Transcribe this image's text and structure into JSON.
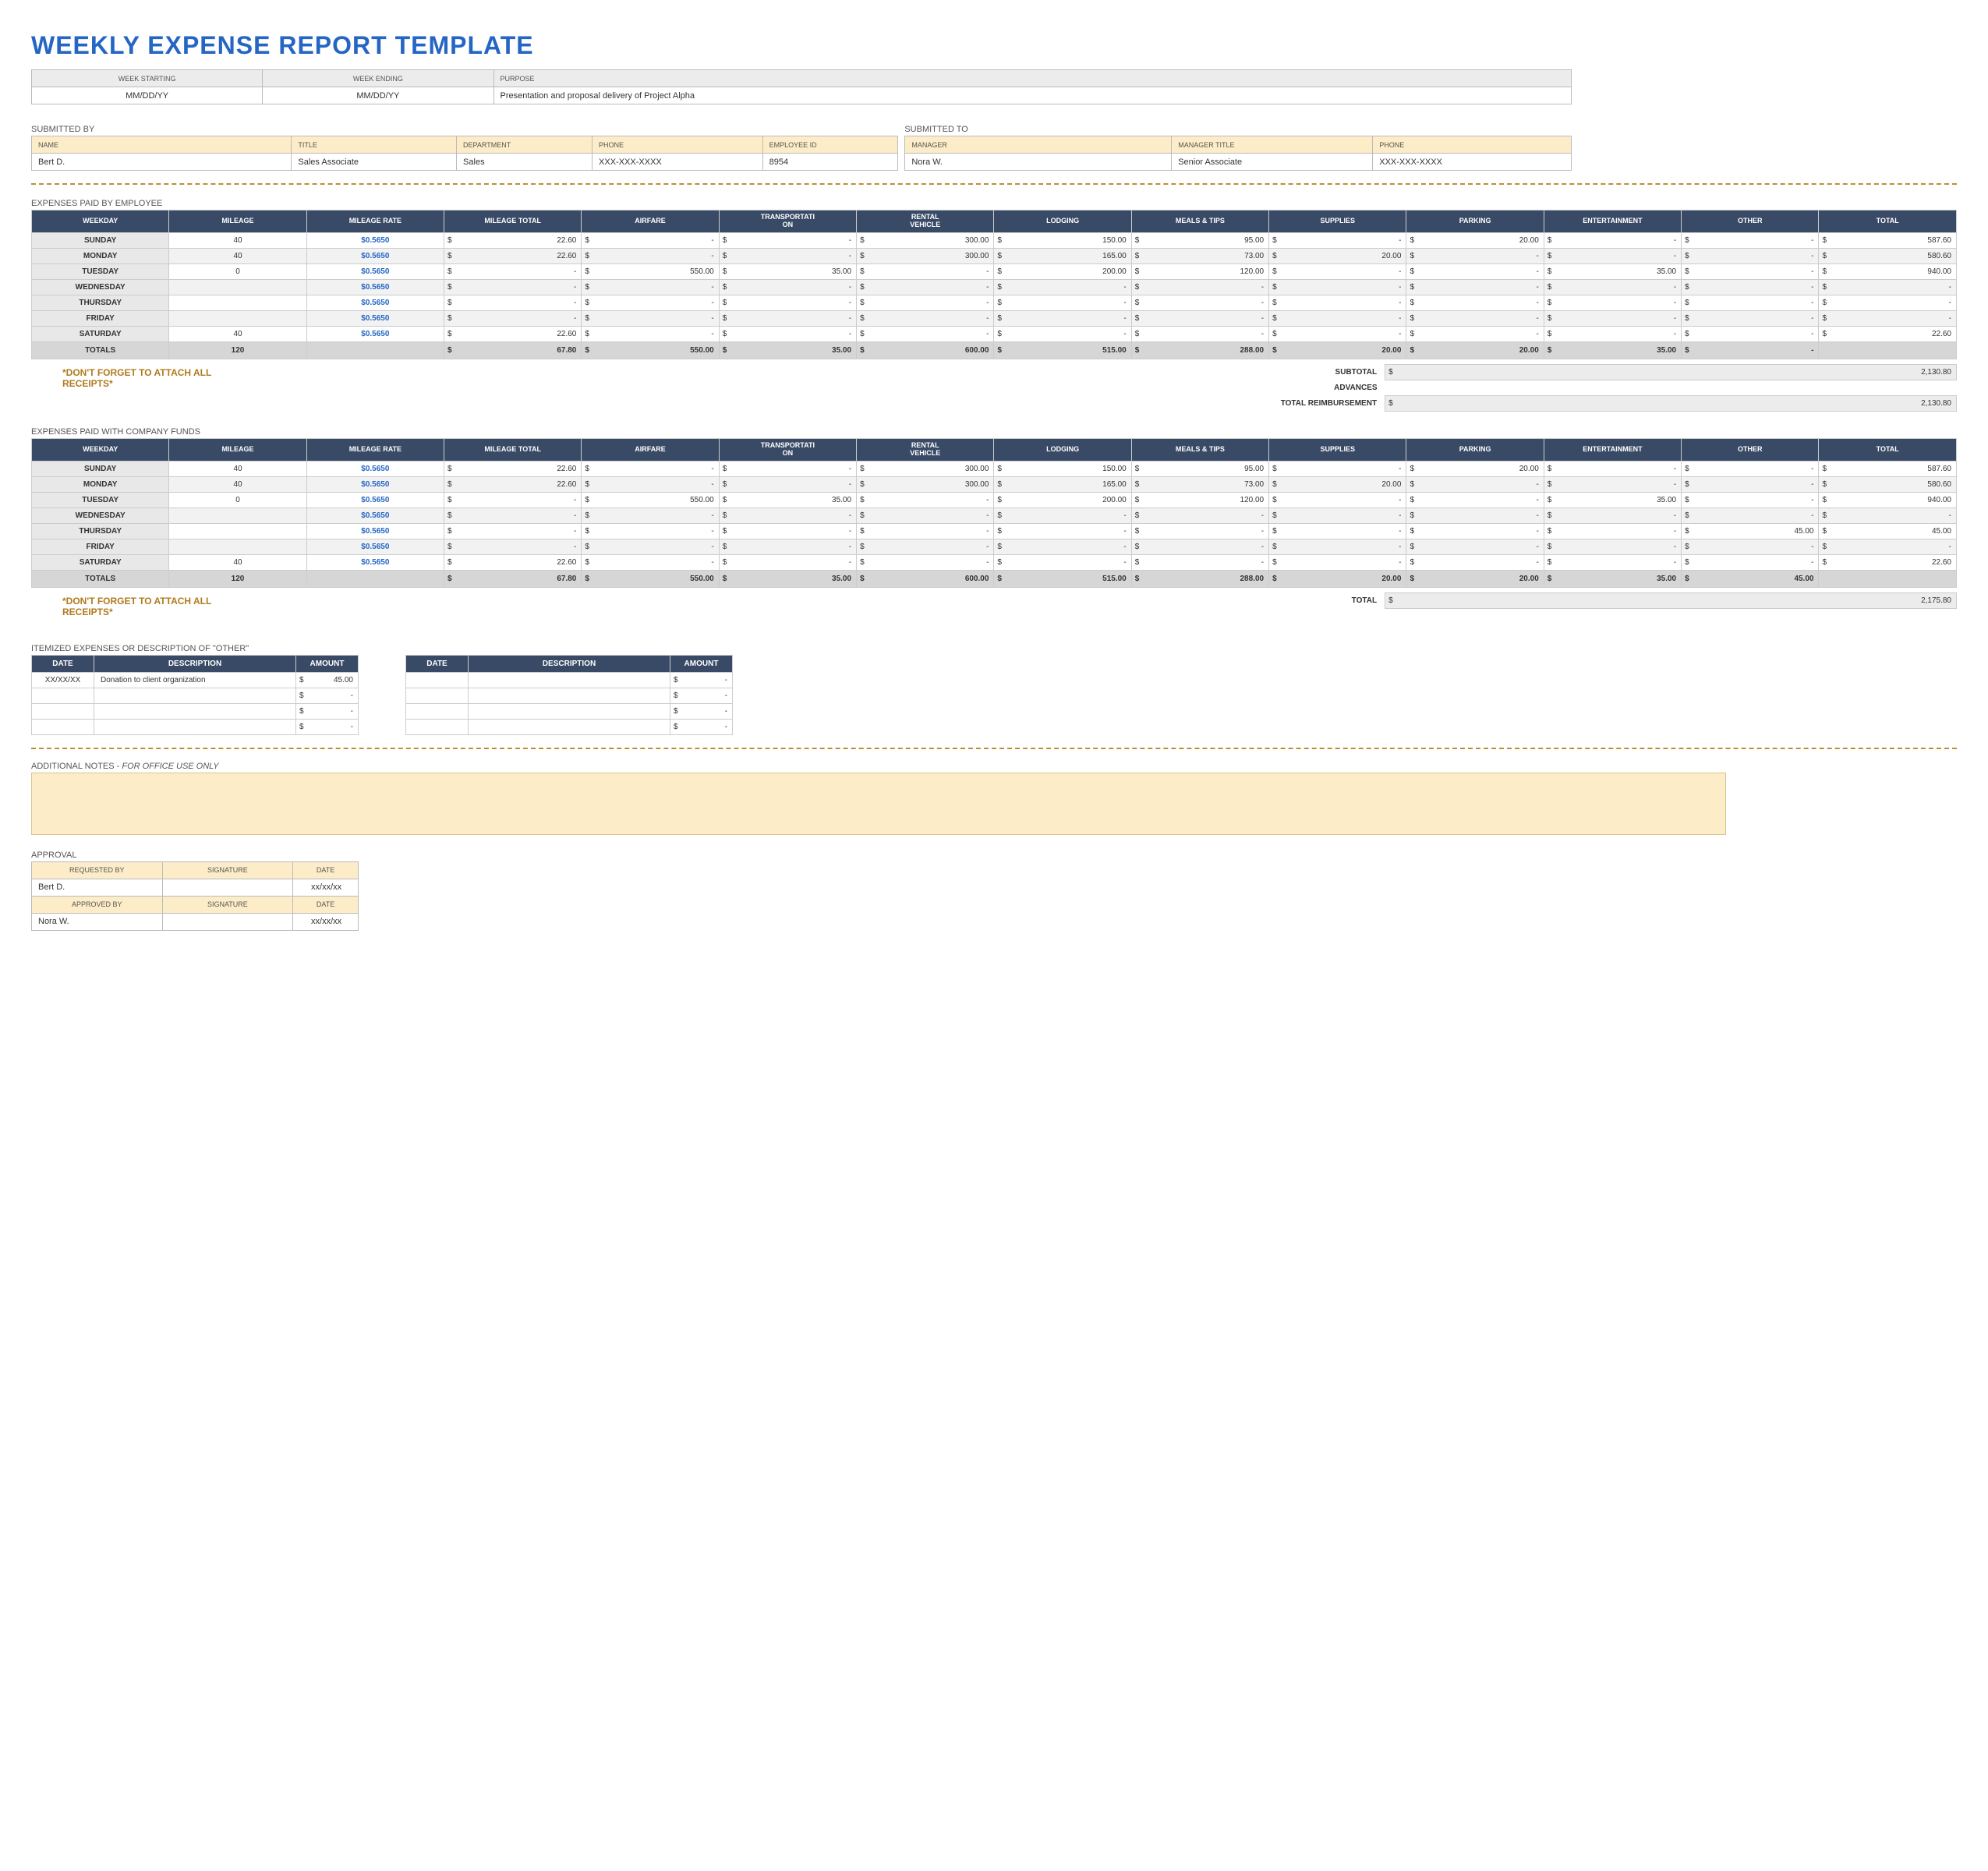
{
  "title": "WEEKLY EXPENSE REPORT TEMPLATE",
  "headerInfo": {
    "labels": {
      "weekStarting": "WEEK STARTING",
      "weekEnding": "WEEK ENDING",
      "purpose": "PURPOSE"
    },
    "weekStarting": "MM/DD/YY",
    "weekEnding": "MM/DD/YY",
    "purpose": "Presentation and proposal delivery of Project Alpha"
  },
  "submittedBy": {
    "title": "SUBMITTED BY",
    "labels": {
      "name": "NAME",
      "jobTitle": "TITLE",
      "department": "DEPARTMENT",
      "phone": "PHONE",
      "employeeId": "EMPLOYEE ID"
    },
    "name": "Bert D.",
    "jobTitle": "Sales Associate",
    "department": "Sales",
    "phone": "XXX-XXX-XXXX",
    "employeeId": "8954"
  },
  "submittedTo": {
    "title": "SUBMITTED TO",
    "labels": {
      "manager": "MANAGER",
      "managerTitle": "MANAGER TITLE",
      "phone": "PHONE"
    },
    "manager": "Nora W.",
    "managerTitle": "Senior Associate",
    "phone": "XXX-XXX-XXXX"
  },
  "expenseCols": [
    "WEEKDAY",
    "MILEAGE",
    "MILEAGE RATE",
    "MILEAGE TOTAL",
    "AIRFARE",
    "TRANSPORTATION",
    "RENTAL VEHICLE",
    "LODGING",
    "MEALS & TIPS",
    "SUPPLIES",
    "PARKING",
    "ENTERTAINMENT",
    "OTHER",
    "TOTAL"
  ],
  "sectionA": {
    "title": "EXPENSES PAID BY EMPLOYEE",
    "rows": [
      {
        "day": "SUNDAY",
        "mileage": "40",
        "rate": "$0.5650",
        "mtotal": "22.60",
        "airfare": "-",
        "trans": "-",
        "rental": "300.00",
        "lodging": "150.00",
        "meals": "95.00",
        "supplies": "-",
        "parking": "20.00",
        "ent": "-",
        "other": "-",
        "total": "587.60"
      },
      {
        "day": "MONDAY",
        "mileage": "40",
        "rate": "$0.5650",
        "mtotal": "22.60",
        "airfare": "-",
        "trans": "-",
        "rental": "300.00",
        "lodging": "165.00",
        "meals": "73.00",
        "supplies": "20.00",
        "parking": "-",
        "ent": "-",
        "other": "-",
        "total": "580.60"
      },
      {
        "day": "TUESDAY",
        "mileage": "0",
        "rate": "$0.5650",
        "mtotal": "-",
        "airfare": "550.00",
        "trans": "35.00",
        "rental": "-",
        "lodging": "200.00",
        "meals": "120.00",
        "supplies": "-",
        "parking": "-",
        "ent": "35.00",
        "other": "-",
        "total": "940.00"
      },
      {
        "day": "WEDNESDAY",
        "mileage": "",
        "rate": "$0.5650",
        "mtotal": "-",
        "airfare": "-",
        "trans": "-",
        "rental": "-",
        "lodging": "-",
        "meals": "-",
        "supplies": "-",
        "parking": "-",
        "ent": "-",
        "other": "-",
        "total": "-"
      },
      {
        "day": "THURSDAY",
        "mileage": "",
        "rate": "$0.5650",
        "mtotal": "-",
        "airfare": "-",
        "trans": "-",
        "rental": "-",
        "lodging": "-",
        "meals": "-",
        "supplies": "-",
        "parking": "-",
        "ent": "-",
        "other": "-",
        "total": "-"
      },
      {
        "day": "FRIDAY",
        "mileage": "",
        "rate": "$0.5650",
        "mtotal": "-",
        "airfare": "-",
        "trans": "-",
        "rental": "-",
        "lodging": "-",
        "meals": "-",
        "supplies": "-",
        "parking": "-",
        "ent": "-",
        "other": "-",
        "total": "-"
      },
      {
        "day": "SATURDAY",
        "mileage": "40",
        "rate": "$0.5650",
        "mtotal": "22.60",
        "airfare": "-",
        "trans": "-",
        "rental": "-",
        "lodging": "-",
        "meals": "-",
        "supplies": "-",
        "parking": "-",
        "ent": "-",
        "other": "-",
        "total": "22.60"
      }
    ],
    "totals": {
      "label": "TOTALS",
      "mileage": "120",
      "mtotal": "67.80",
      "airfare": "550.00",
      "trans": "35.00",
      "rental": "600.00",
      "lodging": "515.00",
      "meals": "288.00",
      "supplies": "20.00",
      "parking": "20.00",
      "ent": "35.00",
      "other": "-",
      "total": ""
    },
    "summary": {
      "subtotalLabel": "SUBTOTAL",
      "subtotal": "2,130.80",
      "advancesLabel": "ADVANCES",
      "advances": "",
      "reimburseLabel": "TOTAL REIMBURSEMENT",
      "reimburse": "2,130.80"
    }
  },
  "sectionB": {
    "title": "EXPENSES PAID WITH COMPANY FUNDS",
    "rows": [
      {
        "day": "SUNDAY",
        "mileage": "40",
        "rate": "$0.5650",
        "mtotal": "22.60",
        "airfare": "-",
        "trans": "-",
        "rental": "300.00",
        "lodging": "150.00",
        "meals": "95.00",
        "supplies": "-",
        "parking": "20.00",
        "ent": "-",
        "other": "-",
        "total": "587.60"
      },
      {
        "day": "MONDAY",
        "mileage": "40",
        "rate": "$0.5650",
        "mtotal": "22.60",
        "airfare": "-",
        "trans": "-",
        "rental": "300.00",
        "lodging": "165.00",
        "meals": "73.00",
        "supplies": "20.00",
        "parking": "-",
        "ent": "-",
        "other": "-",
        "total": "580.60"
      },
      {
        "day": "TUESDAY",
        "mileage": "0",
        "rate": "$0.5650",
        "mtotal": "-",
        "airfare": "550.00",
        "trans": "35.00",
        "rental": "-",
        "lodging": "200.00",
        "meals": "120.00",
        "supplies": "-",
        "parking": "-",
        "ent": "35.00",
        "other": "-",
        "total": "940.00"
      },
      {
        "day": "WEDNESDAY",
        "mileage": "",
        "rate": "$0.5650",
        "mtotal": "-",
        "airfare": "-",
        "trans": "-",
        "rental": "-",
        "lodging": "-",
        "meals": "-",
        "supplies": "-",
        "parking": "-",
        "ent": "-",
        "other": "-",
        "total": "-"
      },
      {
        "day": "THURSDAY",
        "mileage": "",
        "rate": "$0.5650",
        "mtotal": "-",
        "airfare": "-",
        "trans": "-",
        "rental": "-",
        "lodging": "-",
        "meals": "-",
        "supplies": "-",
        "parking": "-",
        "ent": "-",
        "other": "45.00",
        "total": "45.00"
      },
      {
        "day": "FRIDAY",
        "mileage": "",
        "rate": "$0.5650",
        "mtotal": "-",
        "airfare": "-",
        "trans": "-",
        "rental": "-",
        "lodging": "-",
        "meals": "-",
        "supplies": "-",
        "parking": "-",
        "ent": "-",
        "other": "-",
        "total": "-"
      },
      {
        "day": "SATURDAY",
        "mileage": "40",
        "rate": "$0.5650",
        "mtotal": "22.60",
        "airfare": "-",
        "trans": "-",
        "rental": "-",
        "lodging": "-",
        "meals": "-",
        "supplies": "-",
        "parking": "-",
        "ent": "-",
        "other": "-",
        "total": "22.60"
      }
    ],
    "totals": {
      "label": "TOTALS",
      "mileage": "120",
      "mtotal": "67.80",
      "airfare": "550.00",
      "trans": "35.00",
      "rental": "600.00",
      "lodging": "515.00",
      "meals": "288.00",
      "supplies": "20.00",
      "parking": "20.00",
      "ent": "35.00",
      "other": "45.00",
      "total": ""
    },
    "summary": {
      "totalLabel": "TOTAL",
      "total": "2,175.80"
    }
  },
  "receiptsNote": "*DON'T FORGET TO ATTACH ALL RECEIPTS*",
  "itemized": {
    "title": "ITEMIZED EXPENSES OR DESCRIPTION OF \"OTHER\"",
    "cols": {
      "date": "DATE",
      "desc": "DESCRIPTION",
      "amount": "AMOUNT"
    },
    "left": [
      {
        "date": "XX/XX/XX",
        "desc": "Donation to client organization",
        "amount": "45.00"
      },
      {
        "date": "",
        "desc": "",
        "amount": "-"
      },
      {
        "date": "",
        "desc": "",
        "amount": "-"
      },
      {
        "date": "",
        "desc": "",
        "amount": "-"
      }
    ],
    "right": [
      {
        "date": "",
        "desc": "",
        "amount": "-"
      },
      {
        "date": "",
        "desc": "",
        "amount": "-"
      },
      {
        "date": "",
        "desc": "",
        "amount": "-"
      },
      {
        "date": "",
        "desc": "",
        "amount": "-"
      }
    ]
  },
  "notes": {
    "label": "ADDITIONAL NOTES -",
    "sub": "FOR OFFICE USE ONLY"
  },
  "approval": {
    "title": "APPROVAL",
    "labels": {
      "requestedBy": "REQUESTED BY",
      "approvedBy": "APPROVED BY",
      "signature": "SIGNATURE",
      "date": "DATE"
    },
    "requestedBy": {
      "name": "Bert D.",
      "date": "xx/xx/xx"
    },
    "approvedBy": {
      "name": "Nora W.",
      "date": "xx/xx/xx"
    }
  }
}
